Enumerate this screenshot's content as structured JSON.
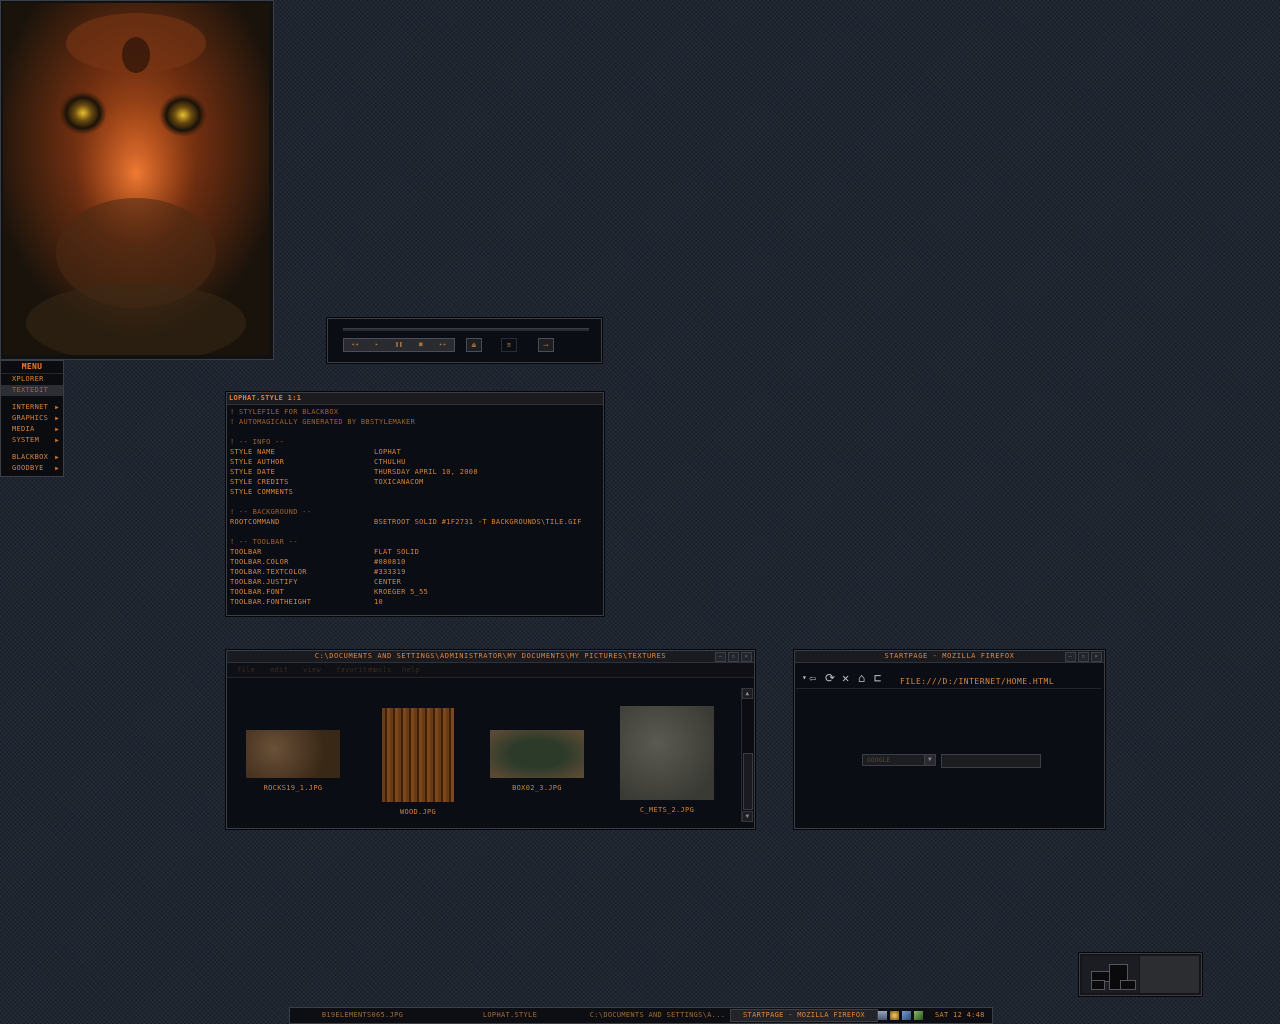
{
  "player": {
    "buttons": [
      "◂◂",
      "▸",
      "❚❚",
      "■",
      "▸▸"
    ],
    "eject_icon": "⏏",
    "eq_icon": "≡",
    "arrow_icon": "⟶"
  },
  "editor": {
    "title": "LOPHAT.STYLE  1:1",
    "lines": [
      {
        "key": "! STYLEFILE FOR BLACKBOX",
        "val": "",
        "comment": true
      },
      {
        "key": "! AUTOMAGICALLY GENERATED BY BBSTYLEMAKER",
        "val": "",
        "comment": true
      },
      {
        "key": "",
        "val": ""
      },
      {
        "key": "! -- INFO --",
        "val": "",
        "comment": true
      },
      {
        "key": "STYLE NAME",
        "val": "LOPHAT"
      },
      {
        "key": "STYLE AUTHOR",
        "val": "CTHULHU"
      },
      {
        "key": "STYLE DATE",
        "val": "THURSDAY APRIL 10, 2008"
      },
      {
        "key": "STYLE CREDITS",
        "val": "TOXICANACOM"
      },
      {
        "key": "STYLE COMMENTS",
        "val": ""
      },
      {
        "key": "",
        "val": ""
      },
      {
        "key": "! -- BACKGROUND --",
        "val": "",
        "comment": true
      },
      {
        "key": "ROOTCOMMAND",
        "val": "BSETROOT SOLID #1F2731 -T BACKGROUNDS\\TILE.GIF"
      },
      {
        "key": "",
        "val": ""
      },
      {
        "key": "! -- TOOLBAR --",
        "val": "",
        "comment": true
      },
      {
        "key": "TOOLBAR",
        "val": "FLAT SOLID"
      },
      {
        "key": "TOOLBAR.COLOR",
        "val": "#080810"
      },
      {
        "key": "TOOLBAR.TEXTCOLOR",
        "val": "#333319"
      },
      {
        "key": "TOOLBAR.JUSTIFY",
        "val": "CENTER"
      },
      {
        "key": "TOOLBAR.FONT",
        "val": "KROEGER 5_55"
      },
      {
        "key": "TOOLBAR.FONTHEIGHT",
        "val": "10"
      }
    ]
  },
  "menu": {
    "title": "MENU",
    "items": [
      {
        "label": "XPLORER",
        "submenu": false,
        "selected": false
      },
      {
        "label": "TEXTEDIT",
        "submenu": false,
        "selected": true
      },
      {
        "sep": true
      },
      {
        "label": "INTERNET",
        "submenu": true
      },
      {
        "label": "GRAPHICS",
        "submenu": true
      },
      {
        "label": "MEDIA",
        "submenu": true
      },
      {
        "label": "SYSTEM",
        "submenu": true
      },
      {
        "sep": true
      },
      {
        "label": "BLACKBOX",
        "submenu": true
      },
      {
        "label": "GOODBYE",
        "submenu": true
      }
    ]
  },
  "explorer": {
    "title": "C:\\DOCUMENTS AND SETTINGS\\ADMINISTRATOR\\MY DOCUMENTS\\MY PICTURES\\TEXTURES",
    "menubar": [
      "file",
      "edit",
      "view",
      "favorites",
      "tools",
      "help"
    ],
    "files": [
      {
        "name": "ROCKS19_1.JPG",
        "color": "#4a3520"
      },
      {
        "name": "WOOD.JPG",
        "color": "#5a3416"
      },
      {
        "name": "BOX02_3.JPG",
        "color": "#3d4433"
      },
      {
        "name": "C_METS_2.JPG",
        "color": "#4a4a44"
      }
    ]
  },
  "firefox": {
    "title": "STARTPAGE - MOZILLA FIREFOX",
    "url": "FILE:///D:/INTERNET/HOME.HTML",
    "engine": "GOOGLE",
    "search_value": ""
  },
  "taskbar": {
    "tasks": [
      {
        "label": "B19ELEMENTS065.JPG",
        "active": false
      },
      {
        "label": "LOPHAT.STYLE",
        "active": false
      },
      {
        "label": "C:\\DOCUMENTS AND SETTINGS\\A...",
        "active": false
      },
      {
        "label": "STARTPAGE - MOZILLA FIREFOX",
        "active": true
      }
    ],
    "clock": "SAT 12  4:48"
  },
  "colors": {
    "accent": "#e0853d",
    "background": "#1e2530"
  }
}
